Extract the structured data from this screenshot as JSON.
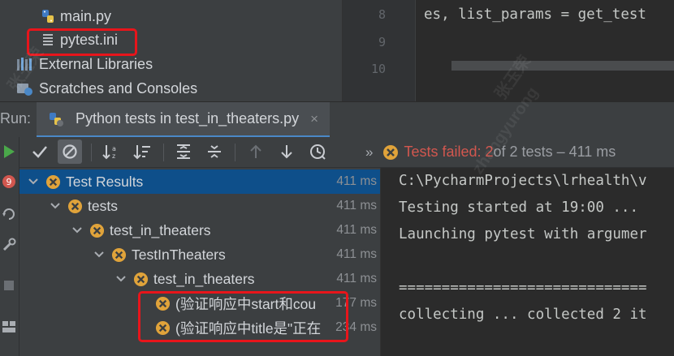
{
  "project_tree": {
    "items": [
      {
        "label": "main.py",
        "icon": "python-file-icon"
      },
      {
        "label": "pytest.ini",
        "icon": "ini-file-icon"
      },
      {
        "label": "External Libraries",
        "icon": "library-icon"
      },
      {
        "label": "Scratches and Consoles",
        "icon": "scratches-icon"
      }
    ]
  },
  "editor": {
    "line_numbers": [
      "8",
      "9",
      "10"
    ],
    "code_line": "es, list_params = get_test"
  },
  "run_panel": {
    "label": "Run:",
    "tab_label": "Python tests in test_in_theaters.py",
    "tab_close": "×"
  },
  "status": {
    "chevron": "»",
    "failed_prefix": "Tests failed: 2",
    "failed_suffix": " of 2 tests – 411 ms"
  },
  "test_tree": [
    {
      "name": "Test Results",
      "time": "411 ms",
      "depth": 0
    },
    {
      "name": "tests",
      "time": "411 ms",
      "depth": 1
    },
    {
      "name": "test_in_theaters",
      "time": "411 ms",
      "depth": 2
    },
    {
      "name": "TestInTheaters",
      "time": "411 ms",
      "depth": 3
    },
    {
      "name": "test_in_theaters",
      "time": "411 ms",
      "depth": 4
    },
    {
      "name": "(验证响应中start和cou",
      "time": "177 ms",
      "depth": 5
    },
    {
      "name": "(验证响应中title是\"正在",
      "time": "234 ms",
      "depth": 5
    }
  ],
  "console": {
    "lines": [
      "C:\\PycharmProjects\\lrhealth\\v",
      "Testing started at 19:00 ...",
      "Launching pytest with argumer",
      "",
      "=============================",
      "collecting ... collected 2 it"
    ]
  },
  "watermark": [
    "张玉荣",
    "zhangyurong",
    "张玉荣"
  ],
  "colors": {
    "accent": "#4a88c7",
    "fail": "#d2574f",
    "warn": "#e0a33a",
    "pass": "#4aa84a",
    "highlight": "#e8151b"
  }
}
